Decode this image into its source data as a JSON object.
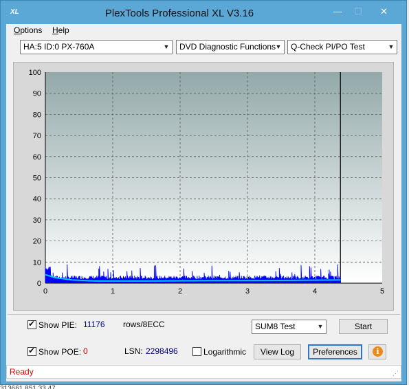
{
  "window": {
    "title": "PlexTools Professional XL V3.16",
    "icon_label": "XL",
    "controls": {
      "minimize": "—",
      "maximize": "☐",
      "close": "✕"
    }
  },
  "menu": {
    "items": [
      "Options",
      "Help"
    ]
  },
  "toolbar": {
    "drive": "HA:5 ID:0  PX-760A",
    "function": "DVD Diagnostic Functions",
    "test": "Q-Check PI/PO Test"
  },
  "chart_data": {
    "type": "line",
    "title": "",
    "xlabel": "",
    "ylabel": "",
    "xlim": [
      0,
      5
    ],
    "ylim": [
      0,
      100
    ],
    "x_ticks": [
      "0",
      "1",
      "2",
      "3",
      "4",
      "5"
    ],
    "y_ticks": [
      "0",
      "10",
      "20",
      "30",
      "40",
      "50",
      "60",
      "70",
      "80",
      "90",
      "100"
    ],
    "grid": true,
    "end_marker_x": 4.38,
    "series": [
      {
        "role": "PI errors (spikes)",
        "color": "#0000ff",
        "peak": 8,
        "typical": 2
      },
      {
        "role": "PI average",
        "color": "#00c8ff",
        "start": 4,
        "mid": 1,
        "end": 1.5
      }
    ]
  },
  "controls": {
    "show_pie": {
      "label": "Show PIE:",
      "checked": true,
      "value": "11176",
      "unit": "rows/8ECC"
    },
    "show_poe": {
      "label": "Show POE:",
      "checked": true,
      "value": "0"
    },
    "lsn": {
      "label": "LSN:",
      "value": "2298496"
    },
    "logarithmic": {
      "label": "Logarithmic",
      "checked": false
    },
    "sum_select": "SUM8 Test",
    "start_button": "Start",
    "view_log_button": "View Log",
    "preferences_button": "Preferences"
  },
  "status": {
    "text": "Ready"
  },
  "background_row": {
    "text": "313661      851      33.47"
  }
}
